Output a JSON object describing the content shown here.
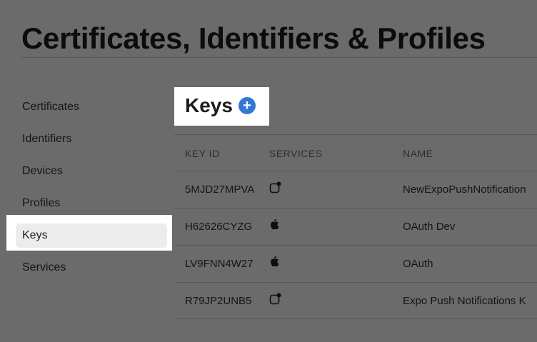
{
  "header": {
    "title": "Certificates, Identifiers & Profiles"
  },
  "sidebar": {
    "items": [
      {
        "label": "Certificates"
      },
      {
        "label": "Identifiers"
      },
      {
        "label": "Devices"
      },
      {
        "label": "Profiles"
      },
      {
        "label": "Keys",
        "active": true
      },
      {
        "label": "Services"
      }
    ]
  },
  "main": {
    "title": "Keys",
    "add_icon": "plus-circle-icon",
    "table": {
      "columns": [
        "KEY ID",
        "SERVICES",
        "NAME"
      ],
      "rows": [
        {
          "key_id": "5MJD27MPVA",
          "service_icon": "push-notification-icon",
          "name": "NewExpoPushNotification"
        },
        {
          "key_id": "H62626CYZG",
          "service_icon": "apple-logo-icon",
          "name": "OAuth Dev"
        },
        {
          "key_id": "LV9FNN4W27",
          "service_icon": "apple-logo-icon",
          "name": "OAuth"
        },
        {
          "key_id": "R79JP2UNB5",
          "service_icon": "push-notification-icon",
          "name": "Expo Push Notifications K"
        }
      ]
    }
  },
  "colors": {
    "accent": "#3478d6",
    "overlay": "rgba(0,0,0,0.58)"
  }
}
